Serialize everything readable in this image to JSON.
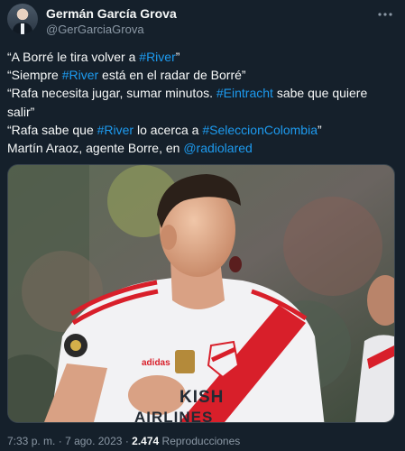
{
  "author": {
    "name": "Germán García Grova",
    "handle": "@GerGarciaGrova"
  },
  "tweet": {
    "lines": [
      [
        {
          "t": "“A Borré le tira volver a "
        },
        {
          "t": "#River",
          "link": true
        },
        {
          "t": "”"
        }
      ],
      [
        {
          "t": "“Siempre "
        },
        {
          "t": "#River",
          "link": true
        },
        {
          "t": " está en el radar de Borré”"
        }
      ],
      [
        {
          "t": "“Rafa necesita jugar, sumar minutos. "
        },
        {
          "t": "#Eintracht",
          "link": true
        },
        {
          "t": " sabe que quiere"
        }
      ],
      [
        {
          "t": "salir”"
        }
      ],
      [
        {
          "t": "“Rafa sabe que "
        },
        {
          "t": "#River",
          "link": true
        },
        {
          "t": " lo acerca a "
        },
        {
          "t": "#SeleccionColombia",
          "link": true
        },
        {
          "t": "”"
        }
      ],
      [
        {
          "t": "Martín Araoz, agente Borre, en "
        },
        {
          "t": "@radiolared",
          "link": true
        }
      ]
    ]
  },
  "media": {
    "jersey_sponsor_line1": "KISH",
    "jersey_sponsor_line2": "AIRLINES",
    "jersey_brand": "adidas"
  },
  "meta": {
    "time": "7:33 p. m.",
    "separator": "·",
    "date": "7 ago. 2023",
    "views_count": "2.474",
    "views_label": "Reproducciones"
  },
  "colors": {
    "background": "#15202b",
    "link": "#1d9bf0",
    "muted": "#8b98a5",
    "jersey_red": "#d81f2a"
  },
  "icons": {
    "more": "more-horizontal-icon"
  }
}
